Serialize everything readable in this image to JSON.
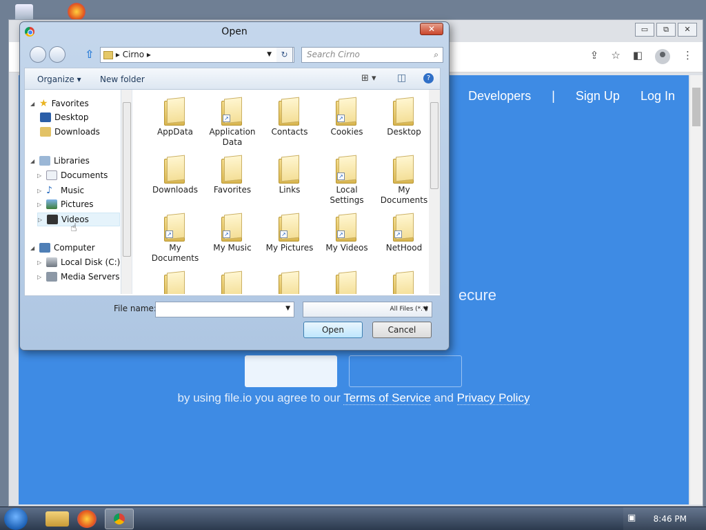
{
  "browser": {
    "window_controls": [
      "▭",
      "⧉",
      "✕"
    ],
    "site": {
      "nav": [
        "Developers",
        "|",
        "Sign Up",
        "Log In"
      ],
      "hero_fragment": "ecure",
      "agree_prefix": "by using file.io you agree to our",
      "terms_link": "Terms of Service",
      "agree_and": "and",
      "privacy_link": "Privacy Policy"
    }
  },
  "dialog": {
    "title": "Open",
    "close_glyph": "✕",
    "breadcrumb": {
      "folder": "Cirno",
      "sep": "▸"
    },
    "search_placeholder": "Search Cirno",
    "organize": "Organize ▾",
    "new_folder": "New folder",
    "tree": [
      {
        "label": "Favorites",
        "expander": "◢"
      },
      {
        "label": "Desktop",
        "expander": ""
      },
      {
        "label": "Downloads",
        "expander": ""
      },
      {
        "label": "Libraries",
        "expander": "◢"
      },
      {
        "label": "Documents",
        "expander": "▷"
      },
      {
        "label": "Music",
        "expander": "▷"
      },
      {
        "label": "Pictures",
        "expander": "▷"
      },
      {
        "label": "Videos",
        "expander": "▷"
      },
      {
        "label": "Computer",
        "expander": "◢"
      },
      {
        "label": "Local Disk (C:)",
        "expander": "▷"
      },
      {
        "label": "Media Servers",
        "expander": "▷"
      }
    ],
    "files": [
      {
        "label": "AppData",
        "badge": false
      },
      {
        "label": "Application Data",
        "badge": true
      },
      {
        "label": "Contacts",
        "badge": false
      },
      {
        "label": "Cookies",
        "badge": true
      },
      {
        "label": "Desktop",
        "badge": false
      },
      {
        "label": "Downloads",
        "badge": false
      },
      {
        "label": "Favorites",
        "badge": false
      },
      {
        "label": "Links",
        "badge": false
      },
      {
        "label": "Local Settings",
        "badge": true
      },
      {
        "label": "My Documents",
        "badge": false
      },
      {
        "label": "My Documents",
        "badge": true
      },
      {
        "label": "My Music",
        "badge": true
      },
      {
        "label": "My Pictures",
        "badge": true
      },
      {
        "label": "My Videos",
        "badge": true
      },
      {
        "label": "NetHood",
        "badge": true
      }
    ],
    "file_name_label": "File name:",
    "file_name_value": "",
    "file_type": "All Files (*.*)",
    "open_button": "Open",
    "cancel_button": "Cancel"
  },
  "taskbar": {
    "clock": "8:46 PM"
  }
}
